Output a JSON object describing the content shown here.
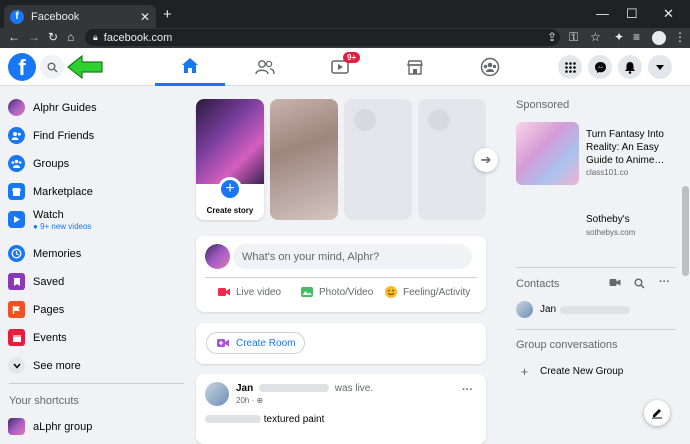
{
  "browser": {
    "tab_title": "Facebook",
    "tab_close": "✕",
    "new_tab": "+",
    "url": "facebook.com",
    "minimize": "—",
    "maximize": "☐",
    "close": "✕"
  },
  "header": {
    "logo": "f",
    "notification_badge": "9+"
  },
  "sidebar": {
    "items": [
      {
        "label": "Alphr Guides",
        "icon": "profile-avatar-icon",
        "color": "#8a5cc4"
      },
      {
        "label": "Find Friends",
        "icon": "friends-icon",
        "color": "#1877f2"
      },
      {
        "label": "Groups",
        "icon": "groups-icon",
        "color": "#1877f2"
      },
      {
        "label": "Marketplace",
        "icon": "marketplace-icon",
        "color": "#1877f2"
      },
      {
        "label": "Watch",
        "sublabel": "9+ new videos",
        "icon": "watch-icon",
        "color": "#1877f2"
      },
      {
        "label": "Memories",
        "icon": "memories-icon",
        "color": "#1877f2"
      },
      {
        "label": "Saved",
        "icon": "saved-icon",
        "color": "#8a3ab9"
      },
      {
        "label": "Pages",
        "icon": "pages-icon",
        "color": "#f25022"
      },
      {
        "label": "Events",
        "icon": "events-icon",
        "color": "#e41e3f"
      },
      {
        "label": "See more",
        "icon": "chevron-down-icon",
        "color": "#e4e6eb"
      }
    ],
    "shortcuts_title": "Your shortcuts",
    "shortcut": "aLphr group"
  },
  "stories": {
    "create_label": "Create story"
  },
  "composer": {
    "placeholder": "What's on your mind, Alphr?",
    "live_video": "Live video",
    "photo_video": "Photo/Video",
    "feeling": "Feeling/Activity"
  },
  "room": {
    "label": "Create Room"
  },
  "post": {
    "author": "Jan",
    "status": "was live.",
    "time": "20h ·",
    "more": "···",
    "text": "textured paint"
  },
  "sponsored": {
    "title": "Sponsored",
    "ad1_title": "Turn Fantasy Into Reality: An Easy Guide to Anime…",
    "ad1_domain": "class101.co",
    "ad2_title": "Sotheby's",
    "ad2_domain": "sothebys.com"
  },
  "contacts": {
    "title": "Contacts",
    "contact1": "Jan",
    "more": "···"
  },
  "group_conversations": {
    "title": "Group conversations",
    "create": "Create New Group"
  },
  "colors": {
    "brand": "#1877f2",
    "background": "#f0f2f5"
  }
}
